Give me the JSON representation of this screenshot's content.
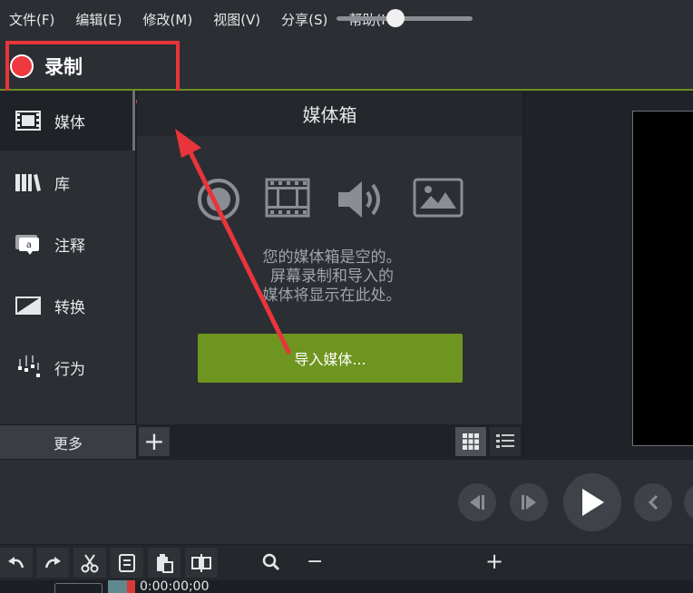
{
  "menu": {
    "items": [
      "文件(F)",
      "编辑(E)",
      "修改(M)",
      "视图(V)",
      "分享(S)",
      "帮助(H)"
    ]
  },
  "record": {
    "label": "录制"
  },
  "sidebar": {
    "items": [
      {
        "label": "媒体",
        "icon": "film-icon"
      },
      {
        "label": "库",
        "icon": "library-icon"
      },
      {
        "label": "注释",
        "icon": "annotation-icon"
      },
      {
        "label": "转换",
        "icon": "transition-icon"
      },
      {
        "label": "行为",
        "icon": "behavior-icon"
      }
    ],
    "more_label": "更多"
  },
  "bin": {
    "title": "媒体箱",
    "empty_line1": "您的媒体箱是空的。",
    "empty_line2": "屏幕录制和导入的",
    "empty_line3": "媒体将显示在此处。",
    "import_label": "导入媒体...",
    "add_label": "+"
  },
  "timeline": {
    "zoom_minus": "−",
    "zoom_plus": "+",
    "zoom_level": 0.43,
    "timecode": "0:00:00;00"
  },
  "colors": {
    "accent_green": "#6f9521",
    "record_red": "#ee3a3e",
    "highlight_red": "#e8353b",
    "panel_bg": "#2b2e33"
  }
}
